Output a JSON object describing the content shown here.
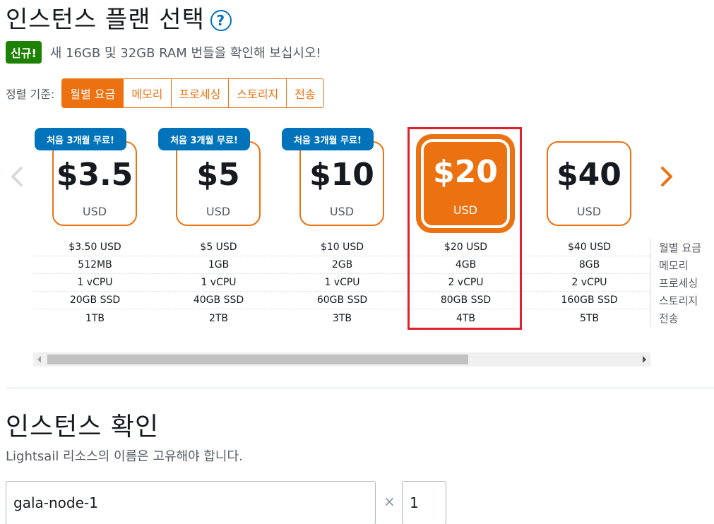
{
  "header": {
    "title": "인스턴스 플랜 선택",
    "help_icon": "question-circle-icon"
  },
  "announcement": {
    "badge": "신규!",
    "text": "새 16GB 및 32GB RAM 번들을 확인해 보십시오!"
  },
  "sort": {
    "label": "정렬 기준:",
    "options": [
      "월별 요금",
      "메모리",
      "프로세싱",
      "스토리지",
      "전송"
    ],
    "selected": "월별 요금"
  },
  "plans": [
    {
      "price": "$3.5",
      "currency": "USD",
      "promo": "처음 3개월 무료!",
      "monthly": "$3.50 USD",
      "memory": "512MB",
      "cpu": "1 vCPU",
      "storage": "20GB SSD",
      "transfer": "1TB"
    },
    {
      "price": "$5",
      "currency": "USD",
      "promo": "처음 3개월 무료!",
      "monthly": "$5 USD",
      "memory": "1GB",
      "cpu": "1 vCPU",
      "storage": "40GB SSD",
      "transfer": "2TB"
    },
    {
      "price": "$10",
      "currency": "USD",
      "promo": "처음 3개월 무료!",
      "monthly": "$10 USD",
      "memory": "2GB",
      "cpu": "1 vCPU",
      "storage": "60GB SSD",
      "transfer": "3TB"
    },
    {
      "price": "$20",
      "currency": "USD",
      "promo": "",
      "monthly": "$20 USD",
      "memory": "4GB",
      "cpu": "2 vCPU",
      "storage": "80GB SSD",
      "transfer": "4TB",
      "selected": true
    },
    {
      "price": "$40",
      "currency": "USD",
      "promo": "",
      "monthly": "$40 USD",
      "memory": "8GB",
      "cpu": "2 vCPU",
      "storage": "160GB SSD",
      "transfer": "5TB"
    }
  ],
  "row_labels": [
    "월별 요금",
    "메모리",
    "프로세싱",
    "스토리지",
    "전송"
  ],
  "carousel": {
    "prev_icon": "chevron-left-icon",
    "next_icon": "chevron-right-icon"
  },
  "instance": {
    "title": "인스턴스 확인",
    "hint": "Lightsail 리소스의 이름은 고유해야 합니다.",
    "name_value": "gala-node-1",
    "times_symbol": "×",
    "count_value": "1"
  },
  "colors": {
    "accent": "#ec7211",
    "promo": "#0073bb",
    "new_badge": "#1d8102",
    "highlight": "#e0202a"
  }
}
